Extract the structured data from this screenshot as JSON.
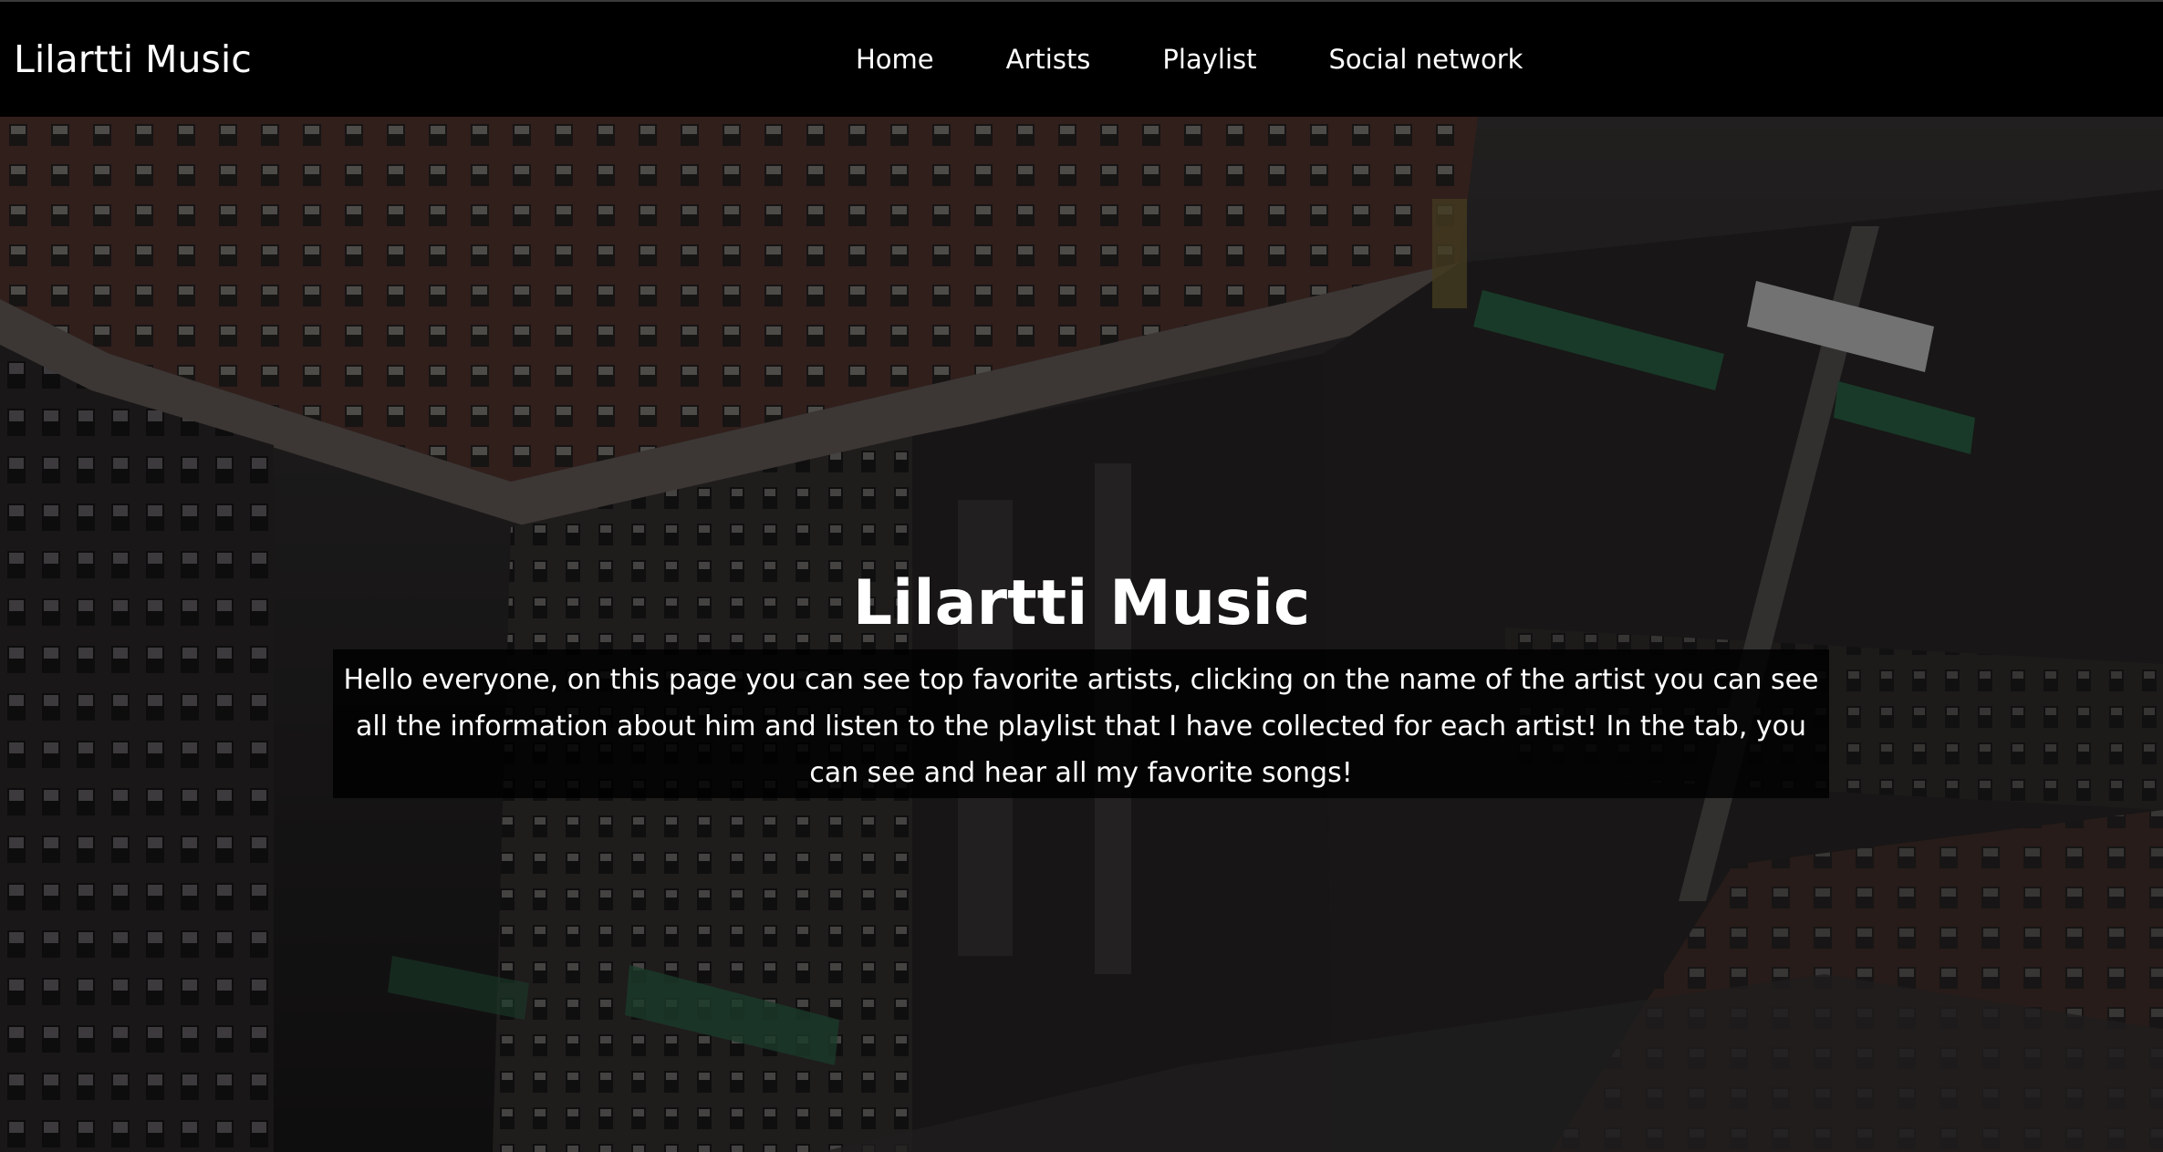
{
  "navbar": {
    "brand": "Lilartti Music",
    "links": [
      {
        "label": "Home"
      },
      {
        "label": "Artists"
      },
      {
        "label": "Playlist"
      },
      {
        "label": "Social network"
      }
    ]
  },
  "hero": {
    "title": "Lilartti Music",
    "description": "Hello everyone, on this page you can see top favorite artists, clicking on the name of the artist you can see all the information about him and listen to the playlist that I have collected for each artist! In the tab, you can see and hear all my favorite songs!",
    "background_image": "city-street-upside-down"
  },
  "colors": {
    "navbar_bg": "#000000",
    "text": "#ffffff",
    "description_bg": "#000000"
  }
}
